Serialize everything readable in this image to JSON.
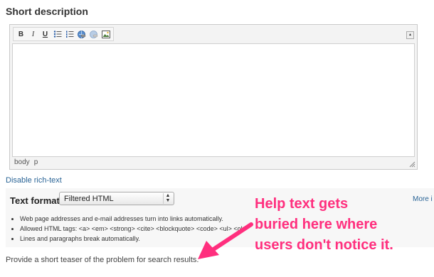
{
  "field": {
    "label": "Short description"
  },
  "toolbar": {
    "buttons": [
      {
        "label": "B",
        "icon": "bold-icon"
      },
      {
        "label": "I",
        "icon": "italic-icon"
      },
      {
        "label": "U",
        "icon": "underline-icon"
      },
      {
        "icon": "bulleted-list-icon"
      },
      {
        "icon": "numbered-list-icon"
      },
      {
        "icon": "link-icon"
      },
      {
        "icon": "unlink-icon"
      },
      {
        "icon": "image-icon"
      }
    ]
  },
  "editor": {
    "path": [
      "body",
      "p"
    ]
  },
  "links": {
    "disable_rich_text": "Disable rich-text"
  },
  "text_format": {
    "label": "Text format",
    "selected": "Filtered HTML",
    "more_info": "More i",
    "tips": [
      "Web page addresses and e-mail addresses turn into links automatically.",
      "Allowed HTML tags: <a> <em> <strong> <cite> <blockquote> <code> <ul> <ol>",
      "Lines and paragraphs break automatically."
    ]
  },
  "help": {
    "text": "Provide a short teaser of the problem for search results."
  },
  "annotation": {
    "lines": [
      "Help text gets",
      "buried here where",
      "users don't notice it."
    ],
    "color": "#ff2f7e"
  }
}
